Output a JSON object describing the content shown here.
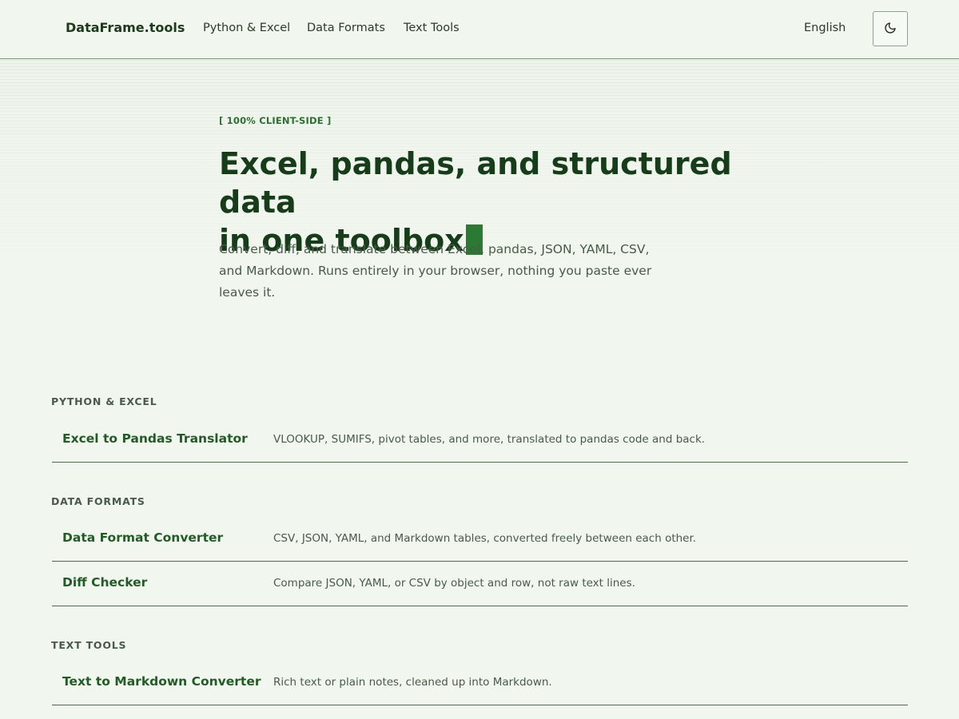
{
  "header": {
    "brand": "DataFrame.tools",
    "nav": [
      "Python & Excel",
      "Data Formats",
      "Text Tools"
    ],
    "language": "English",
    "theme_toggle_icon": "moon-icon"
  },
  "hero": {
    "eyebrow": "[ 100% CLIENT-SIDE ]",
    "title_line1": "Excel, pandas, and structured data",
    "title_line2": "in one toolbox",
    "description": "Convert, diff, and translate between Excel, pandas, JSON, YAML, CSV, and Markdown. Runs entirely in your browser, nothing you paste ever leaves it."
  },
  "sections": [
    {
      "label": "PYTHON & EXCEL",
      "tools": [
        {
          "name": "Excel to Pandas Translator",
          "description": "VLOOKUP, SUMIFS, pivot tables, and more, translated to pandas code and back."
        }
      ]
    },
    {
      "label": "DATA FORMATS",
      "tools": [
        {
          "name": "Data Format Converter",
          "description": "CSV, JSON, YAML, and Markdown tables, converted freely between each other."
        },
        {
          "name": "Diff Checker",
          "description": "Compare JSON, YAML, or CSV by object and row, not raw text lines."
        }
      ]
    },
    {
      "label": "TEXT TOOLS",
      "tools": [
        {
          "name": "Text to Markdown Converter",
          "description": "Rich text or plain notes, cleaned up into Markdown."
        }
      ]
    }
  ],
  "colors": {
    "background": "#f1f6ef",
    "accent": "#2a7a33",
    "heading": "#173c1a",
    "link": "#235b27"
  }
}
